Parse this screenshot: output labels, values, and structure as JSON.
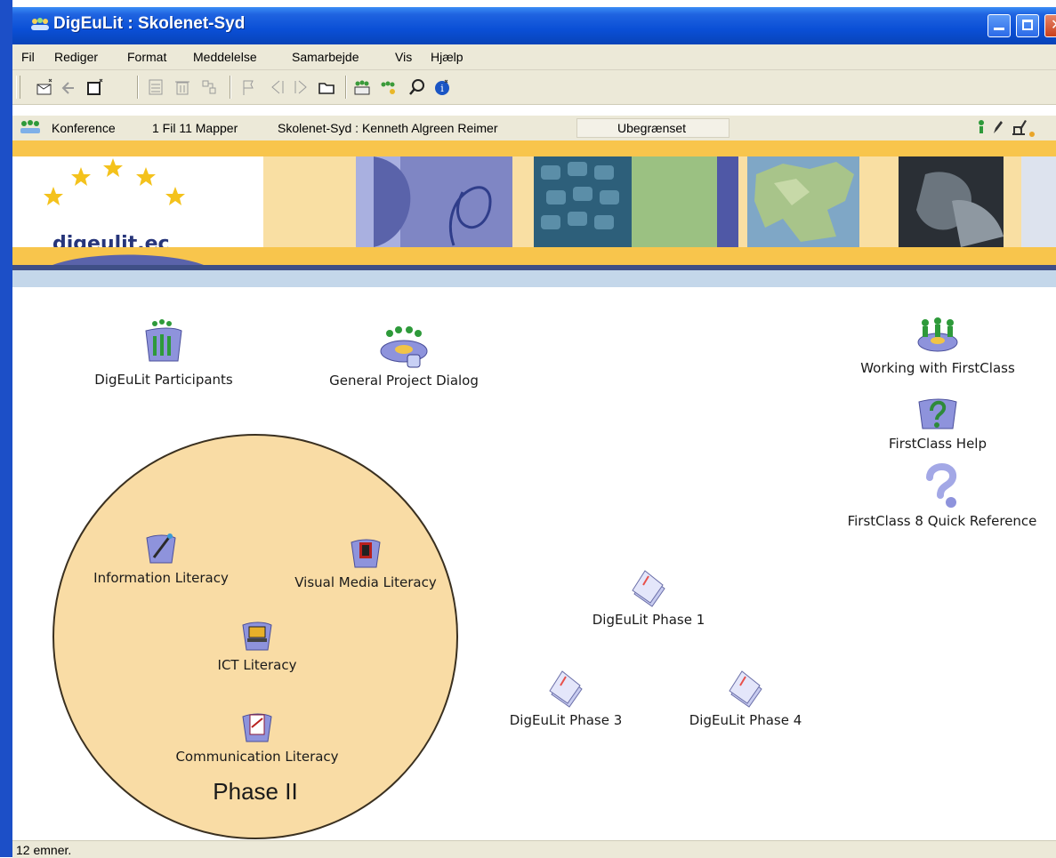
{
  "window": {
    "title": "DigEuLit : Skolenet-Syd"
  },
  "menu": [
    "Fil",
    "Rediger",
    "Format",
    "Meddelelse",
    "Samarbejde",
    "Vis",
    "Hjælp"
  ],
  "info": {
    "type": "Konference",
    "counts": "1 Fil 11 Mapper",
    "owner": "Skolenet-Syd : Kenneth Algreen Reimer",
    "permission": "Ubegrænset"
  },
  "banner": {
    "logo_text": "digeulit.ec"
  },
  "items": {
    "participants": "DigEuLit Participants",
    "general_dialog": "General Project Dialog",
    "working_fc": "Working with FirstClass",
    "fc_help": "FirstClass Help",
    "fc_quickref": "FirstClass 8 Quick Reference",
    "info_lit": "Information Literacy",
    "visual_lit": "Visual Media Literacy",
    "ict_lit": "ICT Literacy",
    "comm_lit": "Communication Literacy",
    "phase1": "DigEuLit Phase 1",
    "phase3": "DigEuLit Phase 3",
    "phase4": "DigEuLit Phase 4"
  },
  "phase_group": {
    "label": "Phase II"
  },
  "status": {
    "text": "12 emner."
  },
  "colors": {
    "titlebar": "#0a4fd6",
    "phase_circle": "#f9dca5",
    "banner_gold": "#f8c54c"
  }
}
